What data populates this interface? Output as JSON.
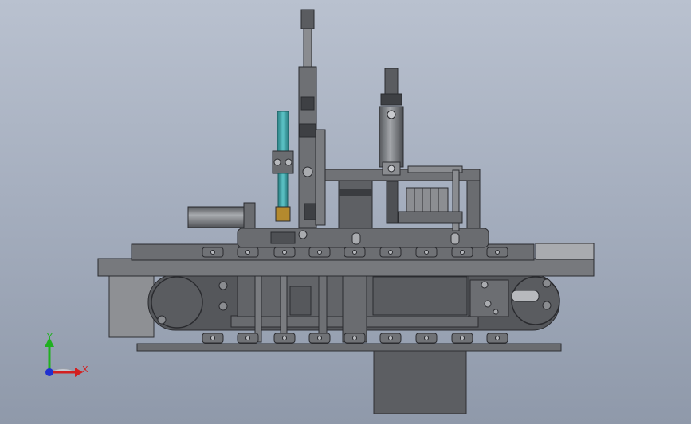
{
  "viewport": {
    "background_top": "#b9c1cf",
    "background_bottom": "#8f99aa"
  },
  "model": {
    "description_colors": {
      "steel": "#5f6166",
      "steel_dark": "#3c3e43",
      "steel_light": "#8a8c90",
      "cylinder": "#7d8084",
      "teal_part": "#3fa3a6",
      "brass_part": "#b48a2e"
    }
  },
  "triad": {
    "x_label": "X",
    "y_label": "Y",
    "x_color": "#d32020",
    "y_color": "#20b020",
    "z_color": "#2030d0"
  }
}
